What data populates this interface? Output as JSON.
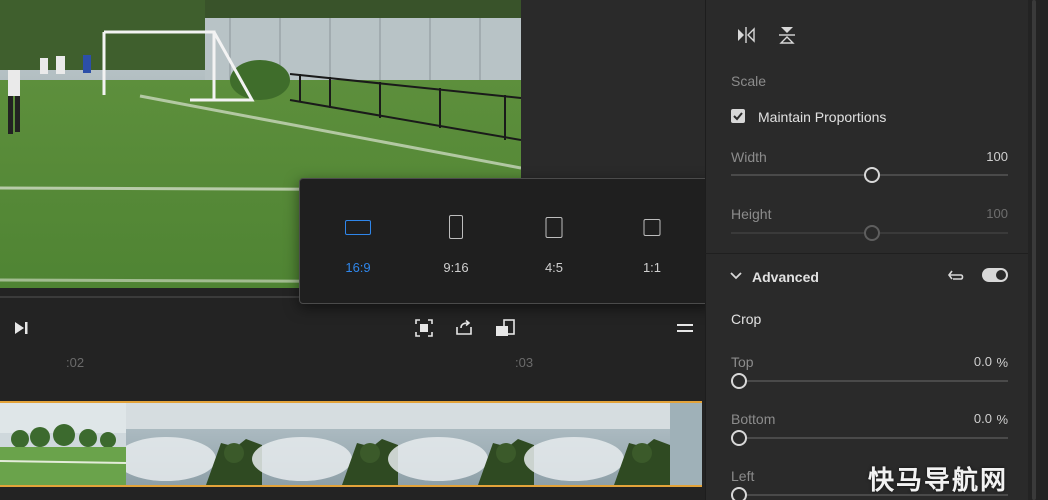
{
  "aspect_popover": {
    "options": [
      {
        "label": "16:9",
        "selected": true
      },
      {
        "label": "9:16",
        "selected": false
      },
      {
        "label": "4:5",
        "selected": false
      },
      {
        "label": "1:1",
        "selected": false
      }
    ],
    "selected_color": "#2f86ea"
  },
  "timeline": {
    "ticks": [
      ":02",
      ":03"
    ],
    "playhead_color": "#e3a33a"
  },
  "panel": {
    "scale_label": "Scale",
    "maintain_proportions_label": "Maintain Proportions",
    "maintain_proportions_checked": true,
    "width": {
      "label": "Width",
      "value": "100",
      "fraction": 0.51
    },
    "height": {
      "label": "Height",
      "value": "100",
      "fraction": 0.51,
      "disabled": true
    },
    "advanced_label": "Advanced",
    "advanced_enabled": true,
    "crop_label": "Crop",
    "crop": {
      "top": {
        "label": "Top",
        "value": "0.0",
        "unit": "%",
        "fraction": 0.0
      },
      "bottom": {
        "label": "Bottom",
        "value": "0.0",
        "unit": "%",
        "fraction": 0.0
      },
      "left": {
        "label": "Left"
      }
    }
  },
  "icons": [
    "flip-horizontal-icon",
    "flip-vertical-icon",
    "step-forward-icon",
    "fit-frame-icon",
    "rotate-icon",
    "resize-icon",
    "menu-icon",
    "reset-icon",
    "chevron-down-icon"
  ],
  "watermark": "快马导航网"
}
